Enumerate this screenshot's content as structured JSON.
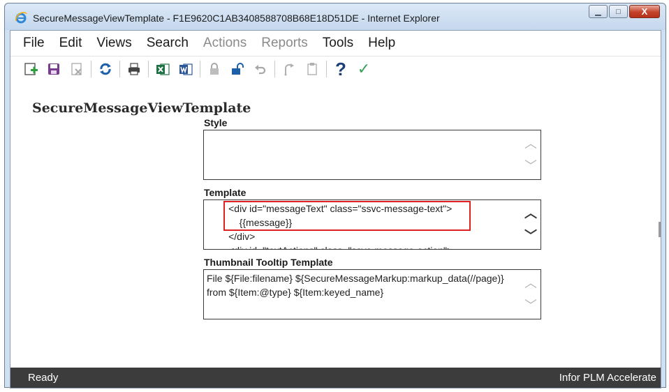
{
  "window": {
    "title": "SecureMessageViewTemplate - F1E9620C1AB3408588708B68E18D51DE - Internet Explorer",
    "minimize_glyph": "▁",
    "maximize_glyph": "□",
    "close_glyph": "X"
  },
  "menu": [
    {
      "label": "File",
      "enabled": true
    },
    {
      "label": "Edit",
      "enabled": true
    },
    {
      "label": "Views",
      "enabled": true
    },
    {
      "label": "Search",
      "enabled": true
    },
    {
      "label": "Actions",
      "enabled": false
    },
    {
      "label": "Reports",
      "enabled": false
    },
    {
      "label": "Tools",
      "enabled": true
    },
    {
      "label": "Help",
      "enabled": true
    }
  ],
  "toolbar": {
    "icons": [
      "new-icon",
      "save-icon",
      "discard-icon",
      "refresh-icon",
      "print-icon",
      "excel-export-icon",
      "word-export-icon",
      "lock-icon",
      "unlock-icon",
      "undo-icon",
      "promote-icon",
      "copy-icon",
      "help-icon",
      "done-icon"
    ],
    "help_glyph": "?",
    "done_glyph": "✓"
  },
  "form": {
    "title": "SecureMessageViewTemplate",
    "style_label": "Style",
    "style_value": "",
    "template_label": "Template",
    "template_lines": [
      "        <div id=\"messageText\" class=\"ssvc-message-text\">",
      "            {{message}}",
      "        </div>",
      "        <div id=\"textActions\" class=\"ssvc-message-action\">"
    ],
    "tooltip_label": "Thumbnail Tooltip Template",
    "tooltip_lines": [
      "File ${File:filename} ${SecureMessageMarkup:markup_data(//page)}",
      "from ${Item:@type} ${Item:keyed_name}"
    ]
  },
  "scroll": {
    "up": "︿",
    "down": "﹀"
  },
  "status": {
    "left": "Ready",
    "right": "Infor PLM Accelerate"
  },
  "colors": {
    "highlight": "#e02020",
    "statusbar": "#3c3c3c",
    "excel": "#1e7145",
    "word": "#2b579a"
  }
}
